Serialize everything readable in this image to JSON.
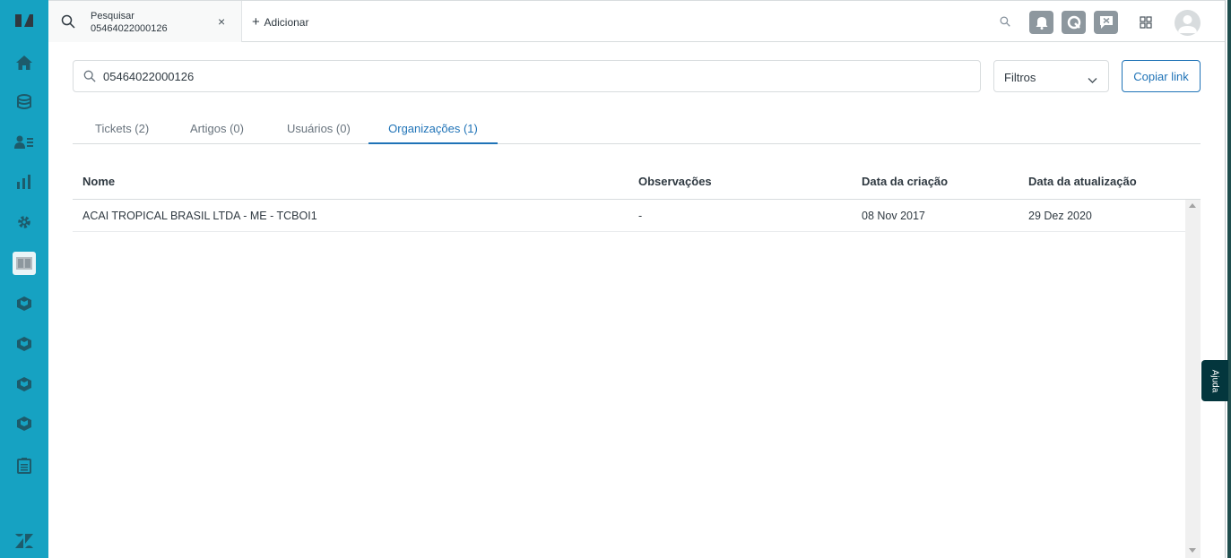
{
  "topbar": {
    "tab_title": "Pesquisar",
    "tab_subtitle": "05464022000126",
    "close_label": "×",
    "add_label": "Adicionar",
    "add_plus": "+"
  },
  "search": {
    "value": "05464022000126",
    "filters_label": "Filtros",
    "copy_link_label": "Copiar link"
  },
  "tabs": [
    {
      "label": "Tickets (2)",
      "active": false
    },
    {
      "label": "Artigos (0)",
      "active": false
    },
    {
      "label": "Usuários (0)",
      "active": false
    },
    {
      "label": "Organizações (1)",
      "active": true
    }
  ],
  "table": {
    "headers": [
      "Nome",
      "Observações",
      "Data da criação",
      "Data da atualização"
    ],
    "rows": [
      [
        "ACAI TROPICAL BRASIL LTDA - ME - TCBOI1",
        "-",
        "08 Nov 2017",
        "29 Dez 2020"
      ]
    ]
  },
  "help_label": "Ajuda",
  "colors": {
    "sidebar": "#16a2c2",
    "accent": "#1f73b7",
    "help_bg": "#03363d"
  },
  "icons": {
    "sidebar": [
      "zendesk-logo-icon",
      "home-icon",
      "views-icon",
      "customers-icon",
      "reporting-icon",
      "admin-gear-icon",
      "knowledge-icon",
      "app-box-icon",
      "app-box-icon",
      "app-box-icon",
      "app-box-icon",
      "clipboard-icon",
      "zendesk-z-icon"
    ]
  }
}
